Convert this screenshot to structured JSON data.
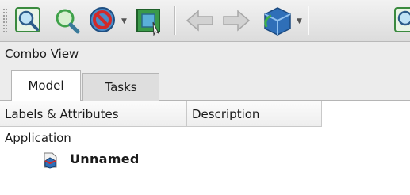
{
  "toolbar": {
    "icons": [
      "fit-all-icon",
      "fit-selection-icon",
      "draw-style-icon",
      "bounding-box-icon",
      "back-arrow-icon",
      "forward-arrow-icon",
      "std-views-icon",
      "fit-all-icon-partial"
    ]
  },
  "panel": {
    "title": "Combo View",
    "tabs": [
      {
        "label": "Model",
        "active": true
      },
      {
        "label": "Tasks",
        "active": false
      }
    ]
  },
  "tree": {
    "columns": [
      "Labels & Attributes",
      "Description"
    ],
    "root_label": "Application",
    "items": [
      {
        "label": "Unnamed",
        "icon": "document-icon"
      }
    ]
  },
  "colors": {
    "toolbar_bg": "#dcdcdc",
    "panel_bg": "#ececec",
    "icon_green": "#3fa14a",
    "icon_blue": "#2f6fb8",
    "icon_red": "#c8272d"
  }
}
